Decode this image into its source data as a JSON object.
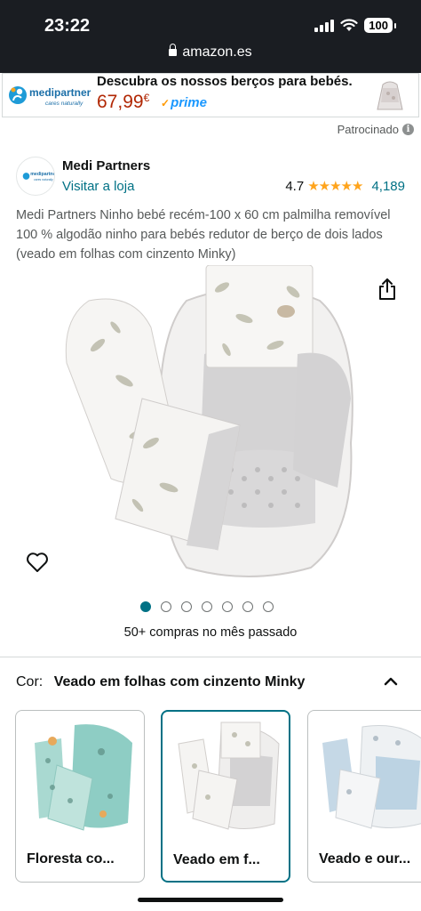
{
  "status": {
    "time": "23:22",
    "battery": "100"
  },
  "browser": {
    "url": "amazon.es"
  },
  "ad": {
    "logo_text": "medipartners",
    "logo_tagline": "cares naturally",
    "headline": "Descubra os nossos berços para bebés.",
    "price": "67,99",
    "currency": "€",
    "prime": "prime",
    "sponsored": "Patrocinado",
    "info": "i"
  },
  "brand": {
    "name": "Medi Partners",
    "visit": "Visitar a loja",
    "rating": "4.7",
    "stars": "★★★★★",
    "rating_count": "4,189"
  },
  "product": {
    "title": "Medi Partners Ninho bebé recém-100 x 60 cm palmilha removível 100 % algodão ninho para bebés redutor de berço de dois lados (veado em folhas com cinzento Minky)",
    "image_count": 7,
    "active_image": 0,
    "bought": "50+ compras no mês passado"
  },
  "color": {
    "label": "Cor:",
    "value": "Veado em folhas com cinzento Minky",
    "variants": [
      {
        "name": "Floresta co...",
        "selected": false
      },
      {
        "name": "Veado em f...",
        "selected": true
      },
      {
        "name": "Veado e our...",
        "selected": false
      }
    ]
  },
  "colors": {
    "link": "#007185",
    "price": "#b12704",
    "star": "#ffa41c",
    "prime": "#1a98ff"
  }
}
